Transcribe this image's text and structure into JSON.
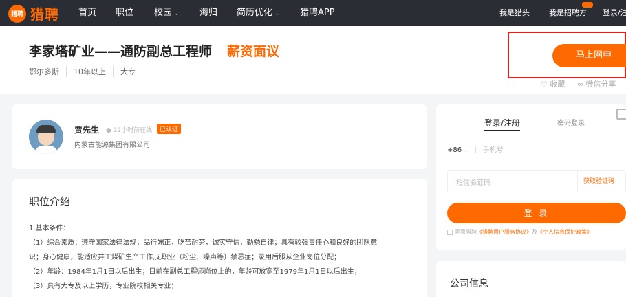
{
  "nav": {
    "logo_badge": "猎聘",
    "logo_text": "猎聘",
    "items": [
      {
        "label": "首页"
      },
      {
        "label": "职位"
      },
      {
        "label": "校园",
        "caret": "⌄"
      },
      {
        "label": "海归"
      },
      {
        "label": "简历优化",
        "caret": "⌄"
      },
      {
        "label": "猎聘APP"
      }
    ],
    "right": [
      "我是猎头",
      "我是招聘方",
      "登录/注"
    ]
  },
  "job": {
    "title": "李家塔矿业——通防副总工程师",
    "salary": "薪资面议",
    "tags": [
      "鄂尔多斯",
      "10年以上",
      "大专"
    ],
    "apply_label": "马上网申",
    "collect_label": "♡ 收藏",
    "share_label": "∞ 微信分享"
  },
  "recruiter": {
    "name": "贾先生",
    "online": "● 22小时前在线",
    "verified": "已认证",
    "company": "内蒙古能源集团有限公司"
  },
  "description": {
    "title": "职位介绍",
    "lines": [
      "1.基本条件：",
      "（1）综合素质：遵守国家法律法规，品行端正，吃苦耐劳，诚实守信，勤勉自律；具有较强责任心和良好的团队意",
      "识；身心健康，能适应井工煤矿生产工作,无职业（粉尘、噪声等）禁忌症；录用后服从企业岗位分配；",
      "（2）年龄：1984年1月1日以后出生；目前在副总工程师岗位上的，年龄可放宽至1979年1月1日以后出生；",
      "（3）具有大专及以上学历，专业院校相关专业；"
    ]
  },
  "login": {
    "tab_active": "登录/注册",
    "tab_password": "密码登录",
    "country_code": "+86",
    "phone_placeholder": "手机号",
    "code_placeholder": "短信验证码",
    "get_code": "获取验证码",
    "submit": "登 录",
    "agree_prefix": "同意猎聘",
    "agree_link1": "《猎聘用户服务协议》",
    "agree_mid": "及",
    "agree_link2": "《个人信息保护政策》"
  },
  "company_panel": {
    "title": "公司信息"
  },
  "colors": {
    "accent": "#ff6a00",
    "nav_bg": "#2a2d33",
    "highlight_box": "#e4201b"
  }
}
